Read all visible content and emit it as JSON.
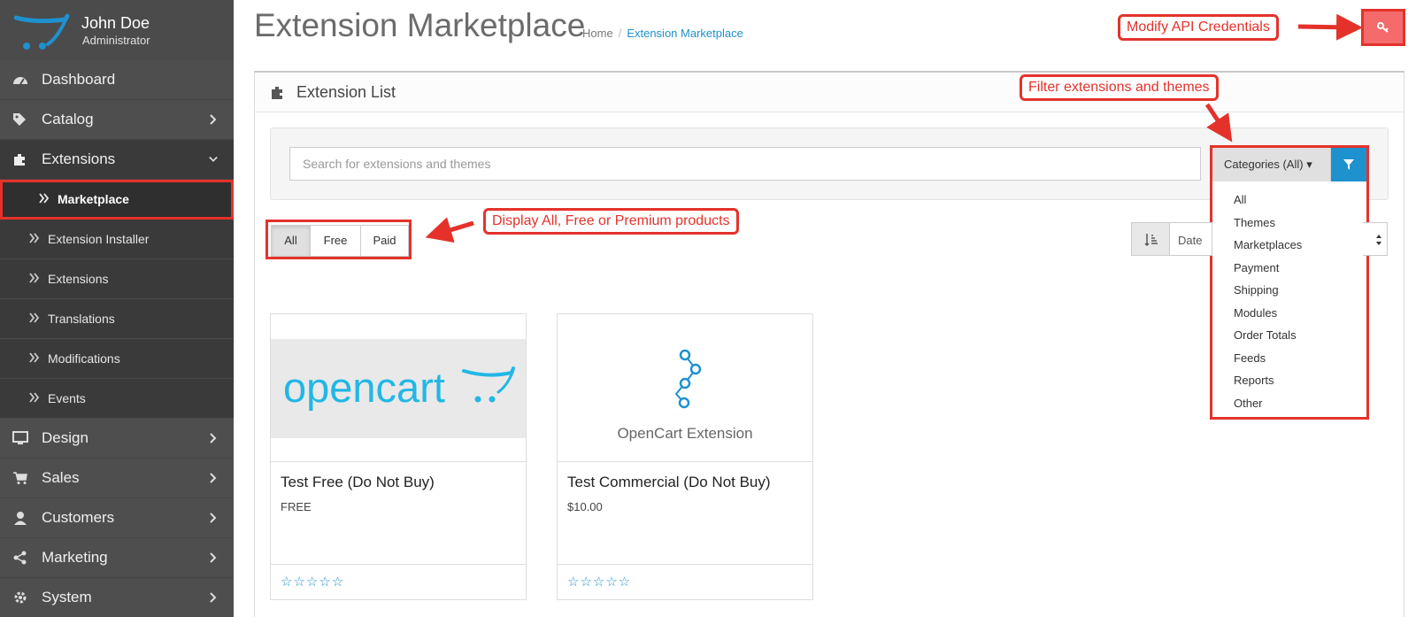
{
  "user": {
    "name": "John Doe",
    "role": "Administrator"
  },
  "nav": {
    "dashboard": "Dashboard",
    "catalog": "Catalog",
    "extensions": "Extensions",
    "sub": {
      "marketplace": "Marketplace",
      "installer": "Extension Installer",
      "extensions": "Extensions",
      "translations": "Translations",
      "modifications": "Modifications",
      "events": "Events"
    },
    "design": "Design",
    "sales": "Sales",
    "customers": "Customers",
    "marketing": "Marketing",
    "system": "System"
  },
  "header": {
    "title": "Extension Marketplace",
    "breadcrumb": [
      "Home",
      "Extension Marketplace"
    ]
  },
  "panel": {
    "title": "Extension List"
  },
  "search": {
    "placeholder": "Search for extensions and themes"
  },
  "categories": {
    "button": "Categories (All)",
    "items": [
      "All",
      "Themes",
      "Marketplaces",
      "Payment",
      "Shipping",
      "Modules",
      "Order Totals",
      "Feeds",
      "Reports",
      "Other"
    ]
  },
  "price_filter": {
    "options": [
      "All",
      "Free",
      "Paid"
    ],
    "selected": "All"
  },
  "sort": {
    "value": "Date"
  },
  "products": [
    {
      "name": "Test Free (Do Not Buy)",
      "price": "FREE",
      "logo_text": "opencart",
      "rating": "☆☆☆☆☆"
    },
    {
      "name": "Test Commercial (Do Not Buy)",
      "price": "$10.00",
      "logo_text": "OpenCart Extension",
      "rating": "☆☆☆☆☆"
    }
  ],
  "annotations": {
    "api": "Modify API Credentials",
    "filter": "Filter extensions and themes",
    "price": "Display All, Free or Premium products"
  },
  "colors": {
    "accent": "#1e91cf",
    "annotation": "#e4322b",
    "sidebar": "#4e4e4e",
    "danger_button": "#f56b6b"
  }
}
